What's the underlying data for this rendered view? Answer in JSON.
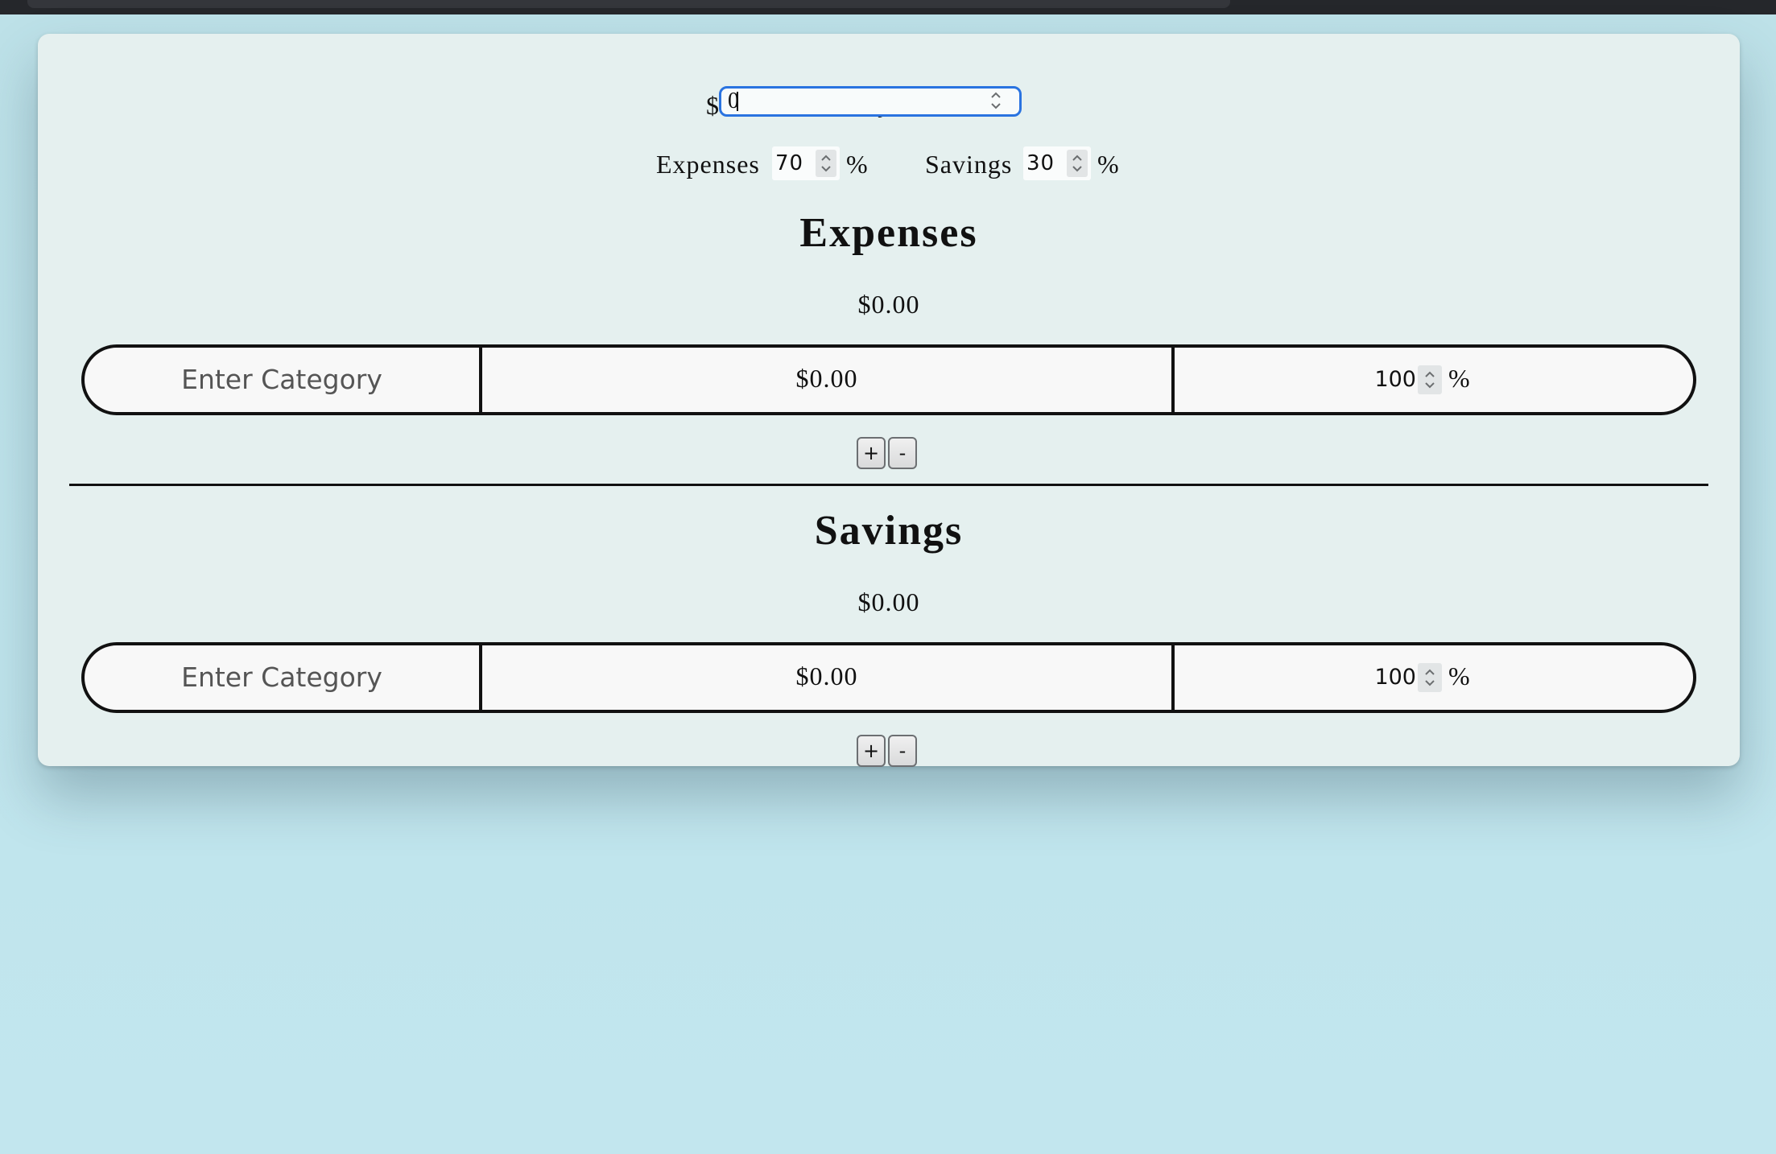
{
  "income": {
    "label": "Monthly Income",
    "currency": "$",
    "value": "0"
  },
  "split": {
    "expenses_label": "Expenses",
    "expenses_value": "70",
    "savings_label": "Savings",
    "savings_value": "30",
    "percent_sign": "%"
  },
  "sections": {
    "expenses": {
      "title": "Expenses",
      "total": "$0.00",
      "row": {
        "category_placeholder": "Enter Category",
        "amount": "$0.00",
        "percent": "100",
        "percent_sign": "%"
      },
      "add_label": "+",
      "remove_label": "-"
    },
    "savings": {
      "title": "Savings",
      "total": "$0.00",
      "row": {
        "category_placeholder": "Enter Category",
        "amount": "$0.00",
        "percent": "100",
        "percent_sign": "%"
      },
      "add_label": "+",
      "remove_label": "-"
    }
  },
  "icons": {
    "stepper": "chevron-up-down-icon"
  },
  "colors": {
    "background": "#bfe3eb",
    "card": "#e5f0ef",
    "focus_ring": "#2a73e0",
    "row_border": "#111111"
  }
}
